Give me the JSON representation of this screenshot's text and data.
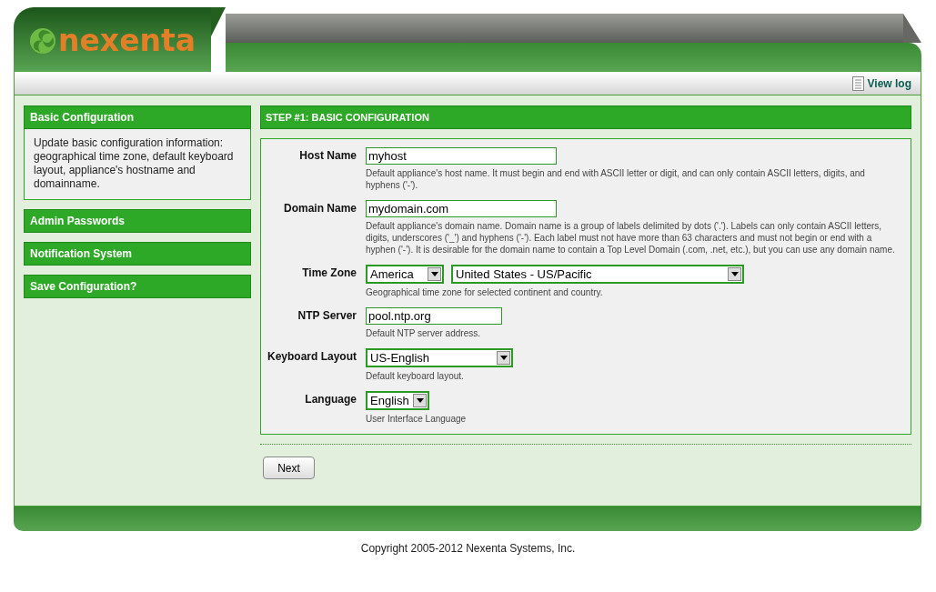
{
  "header": {
    "logo": "nexenta"
  },
  "toolbar": {
    "view_log": "View log"
  },
  "sidebar": {
    "steps": [
      {
        "title": "Basic Configuration",
        "expanded": true,
        "description": "Update basic configuration information: geographical time zone, default keyboard layout, appliance's hostname and domainname."
      },
      {
        "title": "Admin Passwords",
        "expanded": false
      },
      {
        "title": "Notification System",
        "expanded": false
      },
      {
        "title": "Save Configuration?",
        "expanded": false
      }
    ]
  },
  "form": {
    "title": "STEP #1: BASIC CONFIGURATION",
    "fields": [
      {
        "label": "Host Name",
        "kind": "text",
        "controls": [
          {
            "value": "myhost"
          }
        ],
        "help": "Default appliance's host name. It must begin and end with ASCII letter or digit, and can only contain ASCII letters, digits, and hyphens ('-')."
      },
      {
        "label": "Domain Name",
        "kind": "text",
        "controls": [
          {
            "value": "mydomain.com"
          }
        ],
        "help": "Default appliance's domain name. Domain name is a group of labels delimited by dots ('.'). Labels can only contain ASCII letters, digits, underscores ('_') and hyphens ('-'). Each label must not have more than 63 characters and must not begin or end with a hyphen ('-'). It is desirable for the domain name to contain a Top Level Domain (.com, .net, etc.), but you can use any domain name."
      },
      {
        "label": "Time Zone",
        "kind": "select",
        "controls": [
          {
            "value": "America"
          },
          {
            "value": "United States - US/Pacific"
          }
        ],
        "help": "Geographical time zone for selected continent and country."
      },
      {
        "label": "NTP Server",
        "kind": "text",
        "controls": [
          {
            "value": "pool.ntp.org"
          }
        ],
        "help": "Default NTP server address."
      },
      {
        "label": "Keyboard Layout",
        "kind": "select",
        "controls": [
          {
            "value": "US-English"
          }
        ],
        "help": "Default keyboard layout."
      },
      {
        "label": "Language",
        "kind": "select",
        "controls": [
          {
            "value": "English"
          }
        ],
        "help": "User Interface Language"
      }
    ],
    "next_button": "Next"
  },
  "footer": {
    "copyright": "Copyright 2005-2012 Nexenta Systems, Inc."
  }
}
